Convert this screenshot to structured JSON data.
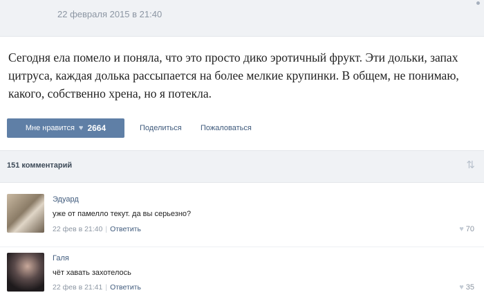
{
  "post": {
    "date": "22 февраля 2015 в 21:40",
    "text": "Сегодня ела помело и поняла, что это просто дико эротичный фрукт. Эти дольки, запах цитруса, каждая долька рассыпается на более мелкие крупинки. В общем, не понимаю, какого, собственно хрена, но я потекла.",
    "like_label": "Мне нравится",
    "like_count": "2664",
    "share_label": "Поделиться",
    "report_label": "Пожаловаться"
  },
  "comments_header": {
    "count_label": "151 комментарий"
  },
  "comments": [
    {
      "author": "Эдуард",
      "text": "уже от памелло текут. да вы серьезно?",
      "date": "22 фев в 21:40",
      "reply_label": "Ответить",
      "likes": "70"
    },
    {
      "author": "Галя",
      "text": "чёт хавать захотелось",
      "date": "22 фев в 21:41",
      "reply_label": "Ответить",
      "likes": "35"
    }
  ],
  "colors": {
    "accent_button": "#5f7fa6",
    "link": "#3f5a7c",
    "muted": "#8c96a3",
    "header_bg": "#f0f2f5"
  },
  "icons": [
    "heart-icon",
    "sort-icon",
    "menu-dots-icon"
  ]
}
